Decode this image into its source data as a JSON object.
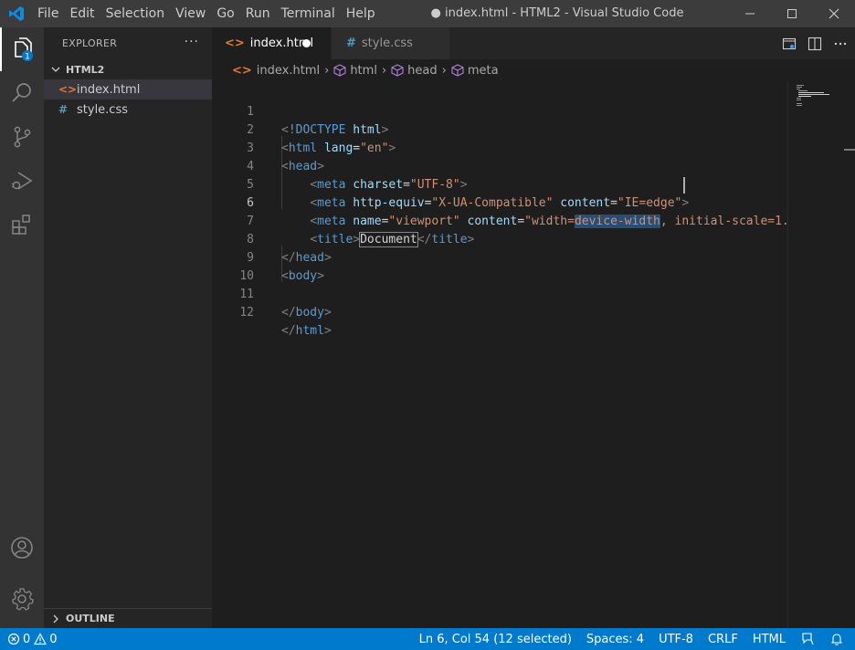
{
  "titlebar": {
    "menu": [
      "File",
      "Edit",
      "Selection",
      "View",
      "Go",
      "Run",
      "Terminal",
      "Help"
    ],
    "window_title": "● index.html - HTML2 - Visual Studio Code"
  },
  "activitybar": {
    "explorer_badge": "1"
  },
  "sidebar": {
    "title": "EXPLORER",
    "more": "···",
    "folder": "HTML2",
    "files": [
      {
        "name": "index.html",
        "icon": "<>",
        "icon_color": "#e37933",
        "selected": true
      },
      {
        "name": "style.css",
        "icon": "#",
        "icon_color": "#519aba",
        "selected": false
      }
    ],
    "outline": "OUTLINE"
  },
  "tabs": [
    {
      "label": "index.html",
      "icon": "<>",
      "icon_color": "#e37933",
      "modified": true
    },
    {
      "label": "style.css",
      "icon": "#",
      "icon_color": "#519aba",
      "modified": false
    }
  ],
  "breadcrumb": {
    "file_icon": "<>",
    "file": "index.html",
    "items": [
      "html",
      "head",
      "meta"
    ]
  },
  "editor": {
    "line_numbers": [
      "1",
      "2",
      "3",
      "4",
      "5",
      "6",
      "7",
      "8",
      "9",
      "10",
      "11",
      "12"
    ],
    "current_line": "6"
  },
  "statusbar": {
    "errors": "0",
    "warnings": "0",
    "position": "Ln 6, Col 54 (12 selected)",
    "spaces": "Spaces: 4",
    "encoding": "UTF-8",
    "eol": "CRLF",
    "language": "HTML"
  },
  "colors": {
    "statusbar": "#007acc",
    "activitybar": "#333333",
    "sidebar": "#252526",
    "editor": "#1e1e1e",
    "selection": "#264f78"
  }
}
